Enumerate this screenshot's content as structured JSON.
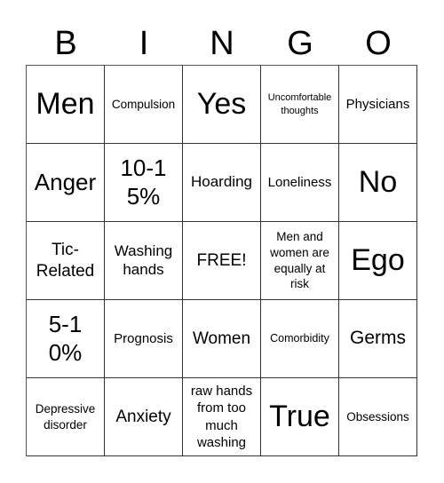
{
  "header": {
    "letters": [
      "B",
      "I",
      "N",
      "G",
      "O"
    ]
  },
  "board": {
    "rows": [
      [
        "Men",
        "Compulsion",
        "Yes",
        "Uncomfortable thoughts",
        "Physicians"
      ],
      [
        "Anger",
        "10-15%",
        "Hoarding",
        "Loneliness",
        "No"
      ],
      [
        "Tic-Related",
        "Washing hands",
        "FREE!",
        "Men and women are equally at risk",
        "Ego"
      ],
      [
        "5-10%",
        "Prognosis",
        "Women",
        "Comorbidity",
        "Germs"
      ],
      [
        "Depressive disorder",
        "Anxiety",
        "raw hands from too much washing",
        "True",
        "Obsessions"
      ]
    ]
  }
}
